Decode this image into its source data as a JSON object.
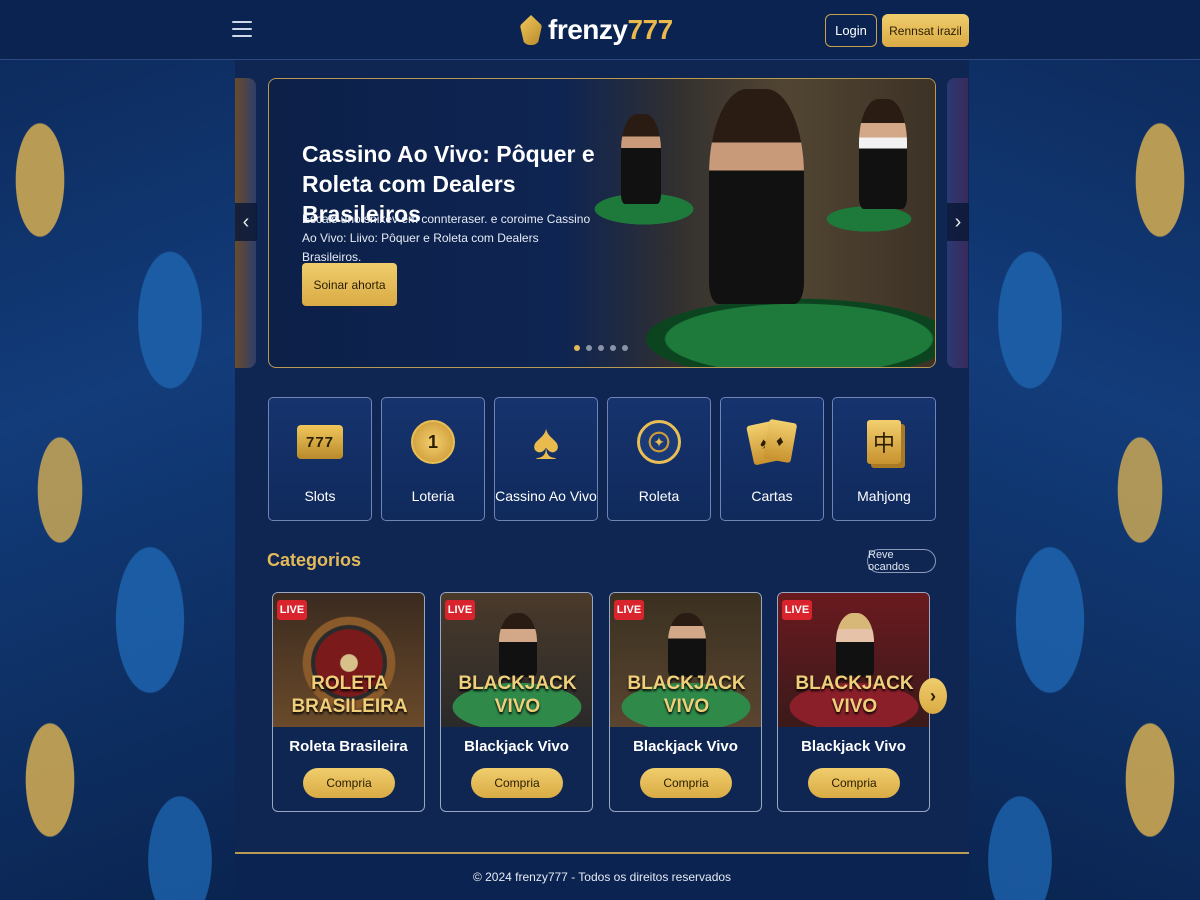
{
  "header": {
    "logo_text_a": "frenzy",
    "logo_text_b": "777",
    "login_label": "Login",
    "register_label": "Rennsat irazil"
  },
  "hero": {
    "title": "Cassino Ao Vivo: Pôquer e Roleta com Dealers Brasileiros",
    "description": "Escals unotsnikev em connteraser. e coroime Cassino Ao Vivo: Liivo: Pôquer e Roleta com Dealers Brasileiros.",
    "cta_label": "Soinar ahorta",
    "arrow_prev": "‹",
    "arrow_next": "›",
    "slides_count": 5,
    "active_slide": 1
  },
  "categories": [
    {
      "label": "Slots",
      "icon": "slot-machine-icon",
      "glyph": "777"
    },
    {
      "label": "Loteria",
      "icon": "lottery-ball-icon",
      "glyph": "1"
    },
    {
      "label": "Cassino Ao Vivo",
      "icon": "spade-icon",
      "glyph": "♠"
    },
    {
      "label": "Roleta",
      "icon": "roulette-icon",
      "glyph": "✦"
    },
    {
      "label": "Cartas",
      "icon": "cards-icon",
      "glyph_a": "♠",
      "glyph_b": "♦"
    },
    {
      "label": "Mahjong",
      "icon": "mahjong-tile-icon",
      "glyph": "中"
    }
  ],
  "games_section": {
    "title": "Categorios",
    "see_all_label": "Reve ocandos",
    "next_arrow": "›",
    "games": [
      {
        "badge": "LIVE",
        "thumb_line1": "ROLETA",
        "thumb_line2": "BRASILEIRA",
        "name": "Roleta Brasileira",
        "button": "Compria"
      },
      {
        "badge": "LIVE",
        "thumb_line1": "BLACKJACK",
        "thumb_line2": "VIVO",
        "name": "Blackjack Vivo",
        "button": "Compria"
      },
      {
        "badge": "LIVE",
        "thumb_line1": "BLACKJACK",
        "thumb_line2": "VIVO",
        "name": "Blackjack Vivo",
        "button": "Compria"
      },
      {
        "badge": "LIVE",
        "thumb_line1": "BLACKJACK",
        "thumb_line2": "VIVO",
        "name": "Blackjack Vivo",
        "button": "Compria"
      }
    ]
  },
  "footer": {
    "text": "© 2024 frenzy777 - Todos os direitos reservados"
  },
  "colors": {
    "background": "#0b2350",
    "gold": "#e4b95a",
    "live_red": "#d9232d"
  }
}
